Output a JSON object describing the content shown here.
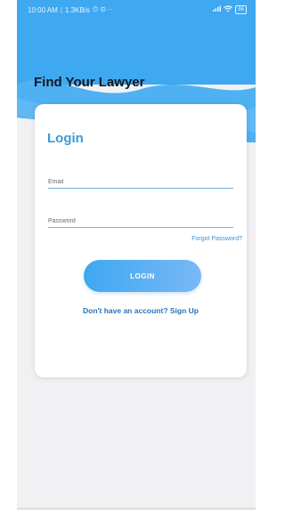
{
  "status_bar": {
    "time": "10:00 AM",
    "separator": "|",
    "network_speed": "1.3KB/s",
    "extra": "⏱ ⊙ ··",
    "battery": "86"
  },
  "app": {
    "title": "Find Your Lawyer",
    "header_color": "#3ea8f0"
  },
  "login": {
    "title": "Login",
    "email_placeholder": "Email",
    "password_placeholder": "Password",
    "forgot_link": "Forgot Password?",
    "login_button": "LOGIN",
    "signup_link": "Don't have an account? Sign Up"
  }
}
